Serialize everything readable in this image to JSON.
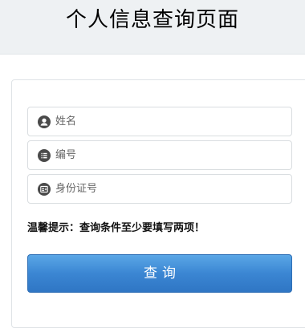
{
  "header": {
    "title": "个人信息查询页面"
  },
  "form": {
    "fields": [
      {
        "icon": "user-icon",
        "placeholder": "姓名",
        "value": ""
      },
      {
        "icon": "list-icon",
        "placeholder": "编号",
        "value": ""
      },
      {
        "icon": "id-card-icon",
        "placeholder": "身份证号",
        "value": ""
      }
    ],
    "tip": "温馨提示：查询条件至少要填写两项！",
    "submit_label": "查询"
  },
  "colors": {
    "header_bg": "#eef1f3",
    "button_top": "#5aa7e6",
    "button_bottom": "#2f76c4",
    "icon_bg": "#4a4a4a"
  }
}
